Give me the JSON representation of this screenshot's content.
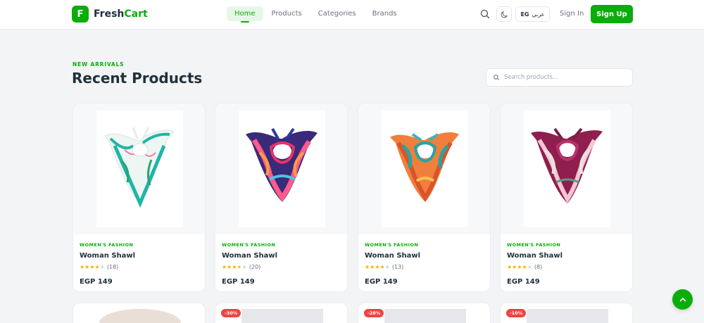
{
  "brand": {
    "logo_letter": "F",
    "name_part1": "Fresh",
    "name_part2": "Cart",
    "accent_color": "#0aad0a"
  },
  "nav": {
    "items": [
      {
        "label": "Home",
        "active": true
      },
      {
        "label": "Categories"
      },
      {
        "label": "Products"
      },
      {
        "label": "Brands"
      }
    ]
  },
  "nav_order": [
    "Home",
    "Products",
    "Categories",
    "Brands"
  ],
  "header": {
    "search_icon": "search-icon",
    "theme_icon": "moon-icon",
    "lang_code": "EG",
    "lang_label": "عربي",
    "signin": "Sign In",
    "signup": "Sign Up"
  },
  "section": {
    "eyebrow": "NEW ARRIVALS",
    "title": "Recent Products",
    "search_placeholder": "Search products..."
  },
  "products": [
    {
      "category": "WOMEN'S FASHION",
      "name": "Woman Shawl",
      "rating": 4,
      "reviews": "(18)",
      "price": "EGP 149"
    },
    {
      "category": "WOMEN'S FASHION",
      "name": "Woman Shawl",
      "rating": 3.5,
      "reviews": "(20)",
      "price": "EGP 149"
    },
    {
      "category": "WOMEN'S FASHION",
      "name": "Woman Shawl",
      "rating": 4,
      "reviews": "(13)",
      "price": "EGP 149"
    },
    {
      "category": "WOMEN'S FASHION",
      "name": "Woman Shawl",
      "rating": 4,
      "reviews": "(8)",
      "price": "EGP 149"
    }
  ],
  "next_row_badges": [
    "",
    "-30%",
    "-28%",
    "-10%"
  ],
  "scroll_top_icon": "arrow-up-icon"
}
